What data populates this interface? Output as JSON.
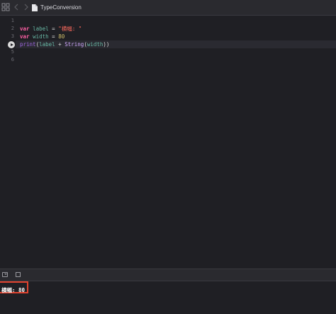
{
  "toolbar": {
    "grid_icon": "grid-icon",
    "back_icon": "chevron-left-icon",
    "forward_icon": "chevron-right-icon",
    "file_icon": "swift-file-icon",
    "file_name": "TypeConversion"
  },
  "editor": {
    "line_numbers": [
      "1",
      "2",
      "3",
      "4",
      "5",
      "6"
    ],
    "active_line": 4,
    "code": {
      "line2": {
        "kw": "var",
        "name": "label",
        "op": " = ",
        "str": "\"横幅: \""
      },
      "line3": {
        "kw": "var",
        "name": "width",
        "op": " = ",
        "num": "80"
      },
      "line4": {
        "fn": "print",
        "open": "(",
        "name1": "label",
        "op": " + ",
        "type": "String",
        "open2": "(",
        "name2": "width",
        "close": "))"
      }
    }
  },
  "debug": {
    "hide_icon": "hide-debug-area-icon",
    "split_icon": "split-view-icon"
  },
  "console": {
    "output": "横幅: 80"
  },
  "colors": {
    "background": "#1f1f24",
    "keyword": "#fc5fa3",
    "string": "#fc6a5d",
    "number": "#d0bf69",
    "highlight_box": "#e1432f"
  }
}
